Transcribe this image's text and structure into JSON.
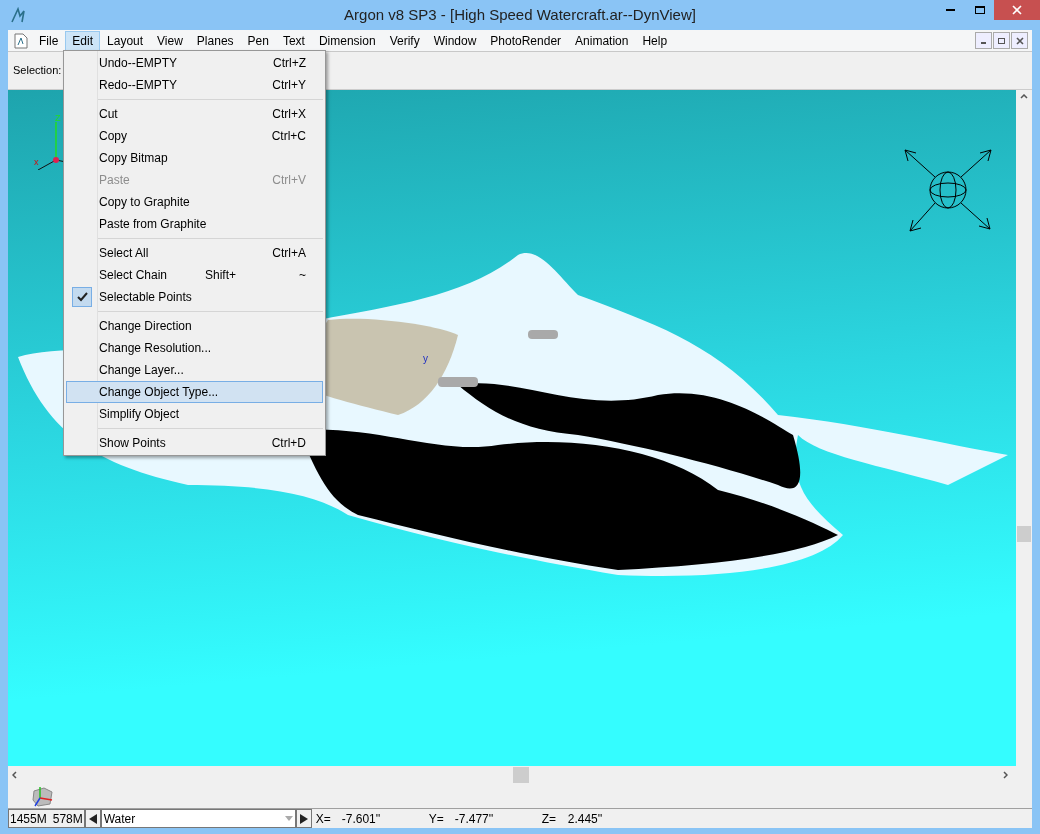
{
  "window": {
    "title": "Argon v8 SP3 - [High Speed Watercraft.ar--DynView]"
  },
  "menu_bar": [
    {
      "label": "File",
      "selected": false
    },
    {
      "label": "Edit",
      "selected": true
    },
    {
      "label": "Layout",
      "selected": false
    },
    {
      "label": "View",
      "selected": false
    },
    {
      "label": "Planes",
      "selected": false
    },
    {
      "label": "Pen",
      "selected": false
    },
    {
      "label": "Text",
      "selected": false
    },
    {
      "label": "Dimension",
      "selected": false
    },
    {
      "label": "Verify",
      "selected": false
    },
    {
      "label": "Window",
      "selected": false
    },
    {
      "label": "PhotoRender",
      "selected": false
    },
    {
      "label": "Animation",
      "selected": false
    },
    {
      "label": "Help",
      "selected": false
    }
  ],
  "toolbar": {
    "label": "Selection:"
  },
  "edit_menu": [
    {
      "kind": "item",
      "label": "Undo--EMPTY",
      "shortcut": "Ctrl+Z",
      "disabled": false,
      "checked": false,
      "selected": false
    },
    {
      "kind": "item",
      "label": "Redo--EMPTY",
      "shortcut": "Ctrl+Y",
      "disabled": false,
      "checked": false,
      "selected": false
    },
    {
      "kind": "separator"
    },
    {
      "kind": "item",
      "label": "Cut",
      "shortcut": "Ctrl+X",
      "disabled": false,
      "checked": false,
      "selected": false
    },
    {
      "kind": "item",
      "label": "Copy",
      "shortcut": "Ctrl+C",
      "disabled": false,
      "checked": false,
      "selected": false
    },
    {
      "kind": "item",
      "label": "Copy Bitmap",
      "disabled": false,
      "checked": false,
      "selected": false
    },
    {
      "kind": "item",
      "label": "Paste",
      "shortcut": "Ctrl+V",
      "disabled": true,
      "checked": false,
      "selected": false
    },
    {
      "kind": "item",
      "label": "Copy to Graphite",
      "disabled": false,
      "checked": false,
      "selected": false
    },
    {
      "kind": "item",
      "label": "Paste from Graphite",
      "disabled": false,
      "checked": false,
      "selected": false
    },
    {
      "kind": "separator"
    },
    {
      "kind": "item",
      "label": "Select All",
      "shortcut": "Ctrl+A",
      "disabled": false,
      "checked": false,
      "selected": false
    },
    {
      "kind": "item",
      "label": "Select Chain",
      "modifier": "Shift+",
      "shortcut": "~",
      "disabled": false,
      "checked": false,
      "selected": false
    },
    {
      "kind": "item",
      "label": "Selectable Points",
      "disabled": false,
      "checked": true,
      "selected": false
    },
    {
      "kind": "separator"
    },
    {
      "kind": "item",
      "label": "Change Direction",
      "disabled": false,
      "checked": false,
      "selected": false
    },
    {
      "kind": "item",
      "label": "Change Resolution...",
      "disabled": false,
      "checked": false,
      "selected": false
    },
    {
      "kind": "item",
      "label": "Change Layer...",
      "disabled": false,
      "checked": false,
      "selected": false
    },
    {
      "kind": "item",
      "label": "Change Object Type...",
      "disabled": false,
      "checked": false,
      "selected": true
    },
    {
      "kind": "item",
      "label": "Simplify Object",
      "disabled": false,
      "checked": false,
      "selected": false
    },
    {
      "kind": "separator"
    },
    {
      "kind": "item",
      "label": "Show Points",
      "shortcut": "Ctrl+D",
      "disabled": false,
      "checked": false,
      "selected": false
    }
  ],
  "viewport": {
    "axis_labels": {
      "z": "Z",
      "x": "x"
    },
    "model_label": "y"
  },
  "status_bar": {
    "memory": [
      "1455M",
      "578M"
    ],
    "layer": "Water",
    "coordinates": [
      {
        "label": "X=",
        "value": "-7.601''"
      },
      {
        "label": "Y=",
        "value": "-7.477''"
      },
      {
        "label": "Z=",
        "value": "2.445''"
      }
    ]
  }
}
